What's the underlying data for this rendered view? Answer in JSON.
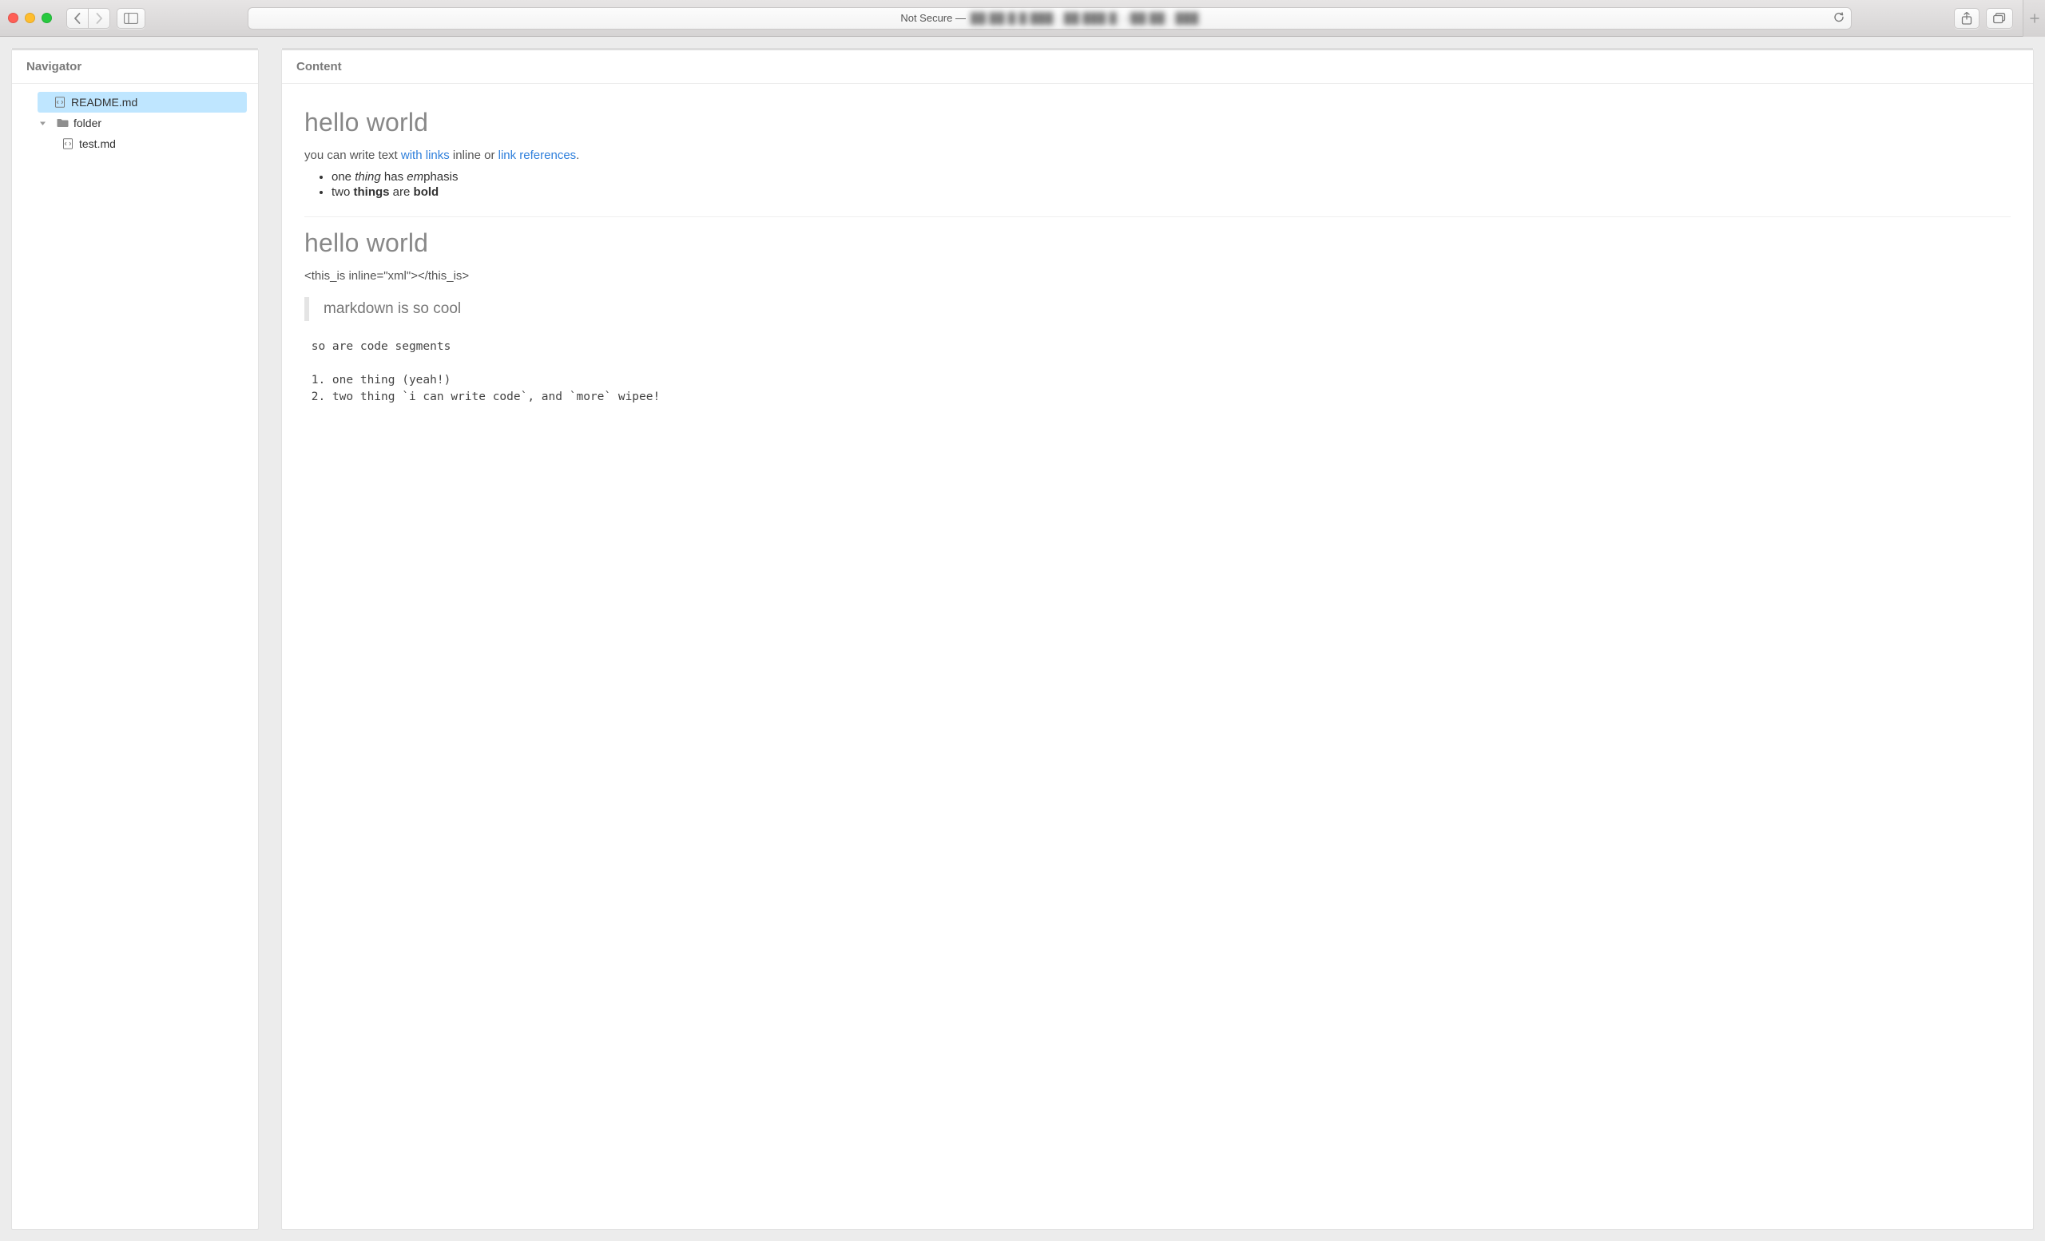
{
  "chrome": {
    "url_prefix": "Not Secure —",
    "url_blurred": "██ ██ █ █ ███ · ██ ███ █ · /██ ██ · ███"
  },
  "sidebar": {
    "title": "Navigator",
    "items": {
      "readme": "README.md",
      "folder": "folder",
      "test": "test.md"
    }
  },
  "content": {
    "title": "Content",
    "h1a": "hello world",
    "p1_pre": "you can write text ",
    "p1_link1": "with links",
    "p1_mid": " inline or ",
    "p1_link2": "link references",
    "p1_post": ".",
    "li1_a": "one ",
    "li1_em": "thing",
    "li1_b": " has ",
    "li1_em2": "em",
    "li1_c": "phasis",
    "li2_a": "two ",
    "li2_bold1": "things",
    "li2_b": " are ",
    "li2_bold2": "bold",
    "h1b": "hello world",
    "xml_line": "<this_is inline=\"xml\"></this_is>",
    "blockquote": "markdown is so cool",
    "codeblock": " so are code segments\n\n 1. one thing (yeah!)\n 2. two thing `i can write code`, and `more` wipee!"
  }
}
